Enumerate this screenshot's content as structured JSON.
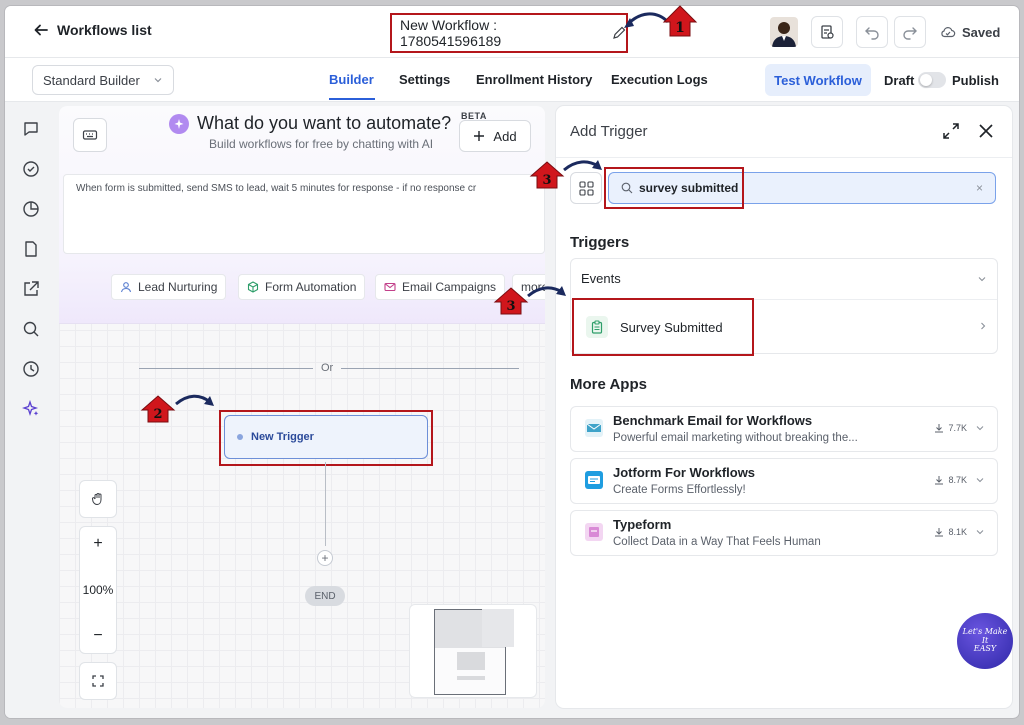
{
  "topbar": {
    "back_label": "Workflows list",
    "workflow_title": "New Workflow : 1780541596189",
    "saved_label": "Saved"
  },
  "subbar": {
    "builder_select": "Standard Builder",
    "tabs": [
      {
        "label": "Builder",
        "active": true
      },
      {
        "label": "Settings",
        "active": false
      },
      {
        "label": "Enrollment History",
        "active": false
      },
      {
        "label": "Execution Logs",
        "active": false
      }
    ],
    "test_button": "Test Workflow",
    "draft_label": "Draft",
    "publish_label": "Publish"
  },
  "ai": {
    "title": "What do you want to automate?",
    "beta": "BETA",
    "subtitle": "Build workflows for free by chatting with AI",
    "add_label": "Add",
    "prompt": "When form is submitted, send SMS to lead, wait 5 minutes for response - if no response cr",
    "chips": [
      "Lead Nurturing",
      "Form Automation",
      "Email Campaigns",
      "more"
    ]
  },
  "canvas": {
    "or_label": "Or",
    "trigger_label": "New Trigger",
    "plus_label": "+",
    "end_label": "END",
    "zoom_in": "+",
    "zoom_level": "100%",
    "zoom_out": "−"
  },
  "panel": {
    "title": "Add Trigger",
    "search_value": "survey submitted",
    "search_clear": "×",
    "triggers_heading": "Triggers",
    "events_label": "Events",
    "event_item": "Survey Submitted",
    "more_apps_heading": "More Apps",
    "apps": [
      {
        "name": "Benchmark Email for Workflows",
        "desc": "Powerful email marketing without breaking the...",
        "downloads": "7.7K",
        "color": "#3fa3c9"
      },
      {
        "name": "Jotform For Workflows",
        "desc": "Create Forms Effortlessly!",
        "downloads": "8.7K",
        "color": "#1f9de0"
      },
      {
        "name": "Typeform",
        "desc": "Collect Data in a Way That Feels Human",
        "downloads": "8.1K",
        "color": "#d98ad6"
      }
    ]
  },
  "annotations": {
    "step1": "1",
    "step2": "2",
    "step3a": "3",
    "step3b": "3"
  },
  "brand": {
    "line1": "Let's Make",
    "line2": "It",
    "line3": "EASY"
  },
  "colors": {
    "accent": "#2b5fd9",
    "annotation_red": "#b4161b"
  }
}
